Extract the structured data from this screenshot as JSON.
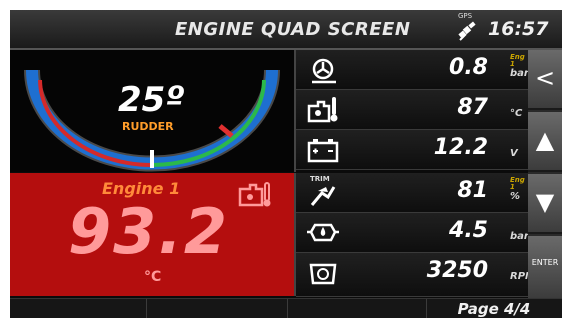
{
  "header": {
    "title": "ENGINE QUAD SCREEN",
    "gps_label": "GPS",
    "time": "16:57"
  },
  "rudder": {
    "angle": "25º",
    "label": "RUDDER",
    "needle_fraction": 0.5
  },
  "engine_panel": {
    "name": "Engine 1",
    "value": "93.2",
    "unit": "°C",
    "alarm_color": "#b40e0e"
  },
  "rows": [
    {
      "icon": "turbo-icon",
      "value": "0.8",
      "unit": "bar",
      "tag": "Eng 1"
    },
    {
      "icon": "oil-temperature-icon",
      "value": "87",
      "unit": "°C",
      "tag": ""
    },
    {
      "icon": "battery-icon",
      "value": "12.2",
      "unit": "V",
      "tag": ""
    },
    {
      "icon": "trim-icon",
      "label": "TRIM",
      "value": "81",
      "unit": "%",
      "tag": "Eng 1"
    },
    {
      "icon": "oil-pressure-icon",
      "value": "4.5",
      "unit": "bar",
      "tag": ""
    },
    {
      "icon": "rpm-icon",
      "value": "3250",
      "unit": "RPM",
      "tag": ""
    }
  ],
  "sidebar": {
    "back": "<",
    "up": "▲",
    "down": "▼",
    "enter": "ENTER"
  },
  "footer": {
    "page": "Page 4/4"
  }
}
